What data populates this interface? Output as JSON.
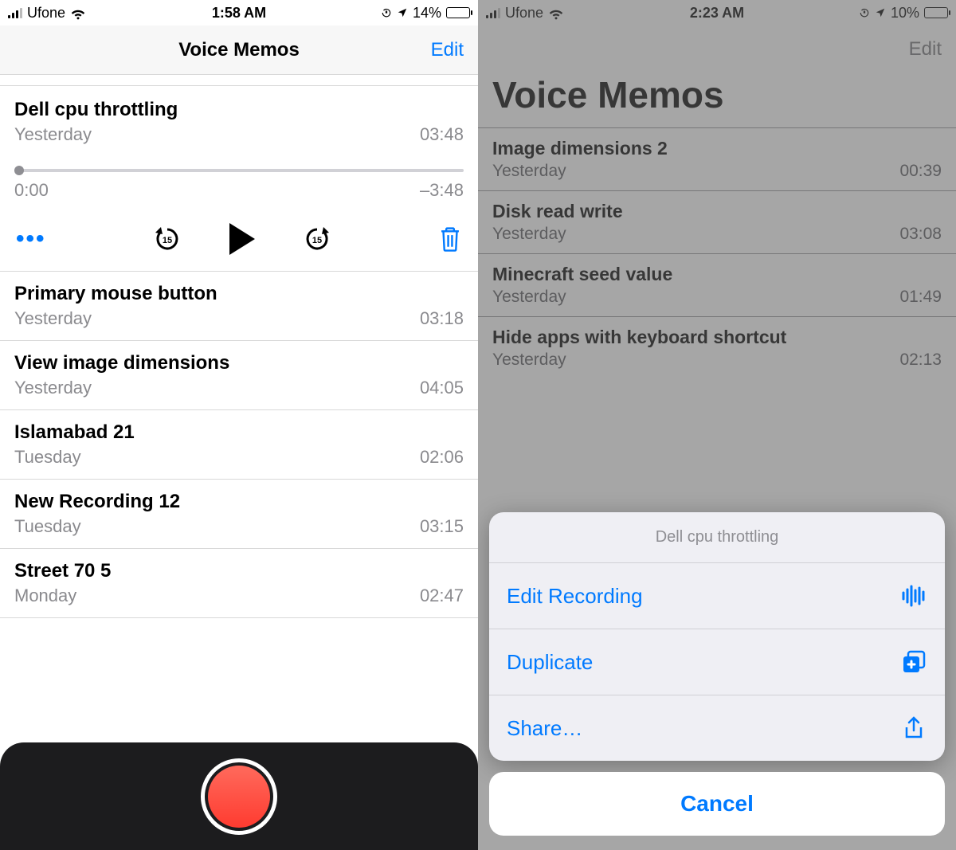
{
  "left": {
    "status": {
      "carrier": "Ufone",
      "time": "1:58 AM",
      "battery_pct": "14%"
    },
    "nav": {
      "title": "Voice Memos",
      "edit": "Edit"
    },
    "expanded": {
      "title": "Dell cpu throttling",
      "date": "Yesterday",
      "duration": "03:48",
      "elapsed": "0:00",
      "remaining": "–3:48"
    },
    "items": [
      {
        "title": "Primary mouse button",
        "date": "Yesterday",
        "duration": "03:18"
      },
      {
        "title": "View image dimensions",
        "date": "Yesterday",
        "duration": "04:05"
      },
      {
        "title": "Islamabad 21",
        "date": "Tuesday",
        "duration": "02:06"
      },
      {
        "title": "New Recording 12",
        "date": "Tuesday",
        "duration": "03:15"
      },
      {
        "title": "Street 70 5",
        "date": "Monday",
        "duration": "02:47"
      }
    ]
  },
  "right": {
    "status": {
      "carrier": "Ufone",
      "time": "2:23 AM",
      "battery_pct": "10%"
    },
    "nav": {
      "edit": "Edit"
    },
    "title": "Voice Memos",
    "items": [
      {
        "title": "Image dimensions 2",
        "date": "Yesterday",
        "duration": "00:39"
      },
      {
        "title": "Disk read write",
        "date": "Yesterday",
        "duration": "03:08"
      },
      {
        "title": "Minecraft seed value",
        "date": "Yesterday",
        "duration": "01:49"
      },
      {
        "title": "Hide apps with keyboard shortcut",
        "date": "Yesterday",
        "duration": "02:13"
      }
    ],
    "sheet": {
      "title": "Dell cpu throttling",
      "edit": "Edit Recording",
      "duplicate": "Duplicate",
      "share": "Share…",
      "cancel": "Cancel"
    }
  }
}
